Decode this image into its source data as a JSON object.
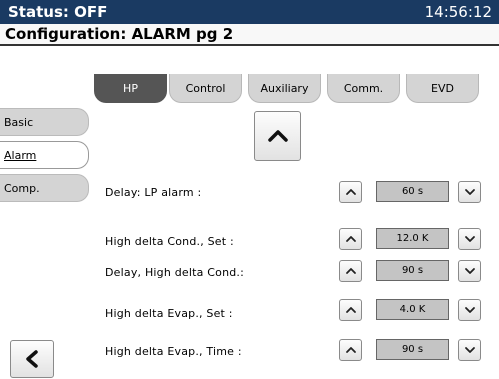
{
  "status": {
    "label": "Status: OFF",
    "time": "14:56:12"
  },
  "config": {
    "title": "Configuration: ALARM pg 2"
  },
  "tabs": [
    {
      "label": "HP",
      "active": true
    },
    {
      "label": "Control",
      "active": false
    },
    {
      "label": "Auxiliary",
      "active": false
    },
    {
      "label": "Comm.",
      "active": false
    },
    {
      "label": "EVD",
      "active": false
    }
  ],
  "side_tabs": [
    {
      "label": "Basic",
      "active": false
    },
    {
      "label": "Alarm",
      "active": true
    },
    {
      "label": "Comp.",
      "active": false
    }
  ],
  "params": [
    {
      "label": "Delay: LP alarm :",
      "value": "60 s"
    },
    {
      "label": "High delta Cond., Set :",
      "value": "12.0 K"
    },
    {
      "label": "Delay, High delta Cond.:",
      "value": "90 s"
    },
    {
      "label": "High delta Evap., Set :",
      "value": "4.0 K"
    },
    {
      "label": "High delta Evap., Time :",
      "value": "90 s"
    }
  ],
  "icons": {
    "page_up": "chevron-up-icon",
    "back": "chevron-left-icon",
    "increment": "chevron-up-icon",
    "decrement": "chevron-down-icon"
  },
  "colors": {
    "status_bar": "#1a3a62",
    "active_tab": "#555555",
    "tab": "#d4d4d4",
    "value_box": "#c4c4c4"
  }
}
